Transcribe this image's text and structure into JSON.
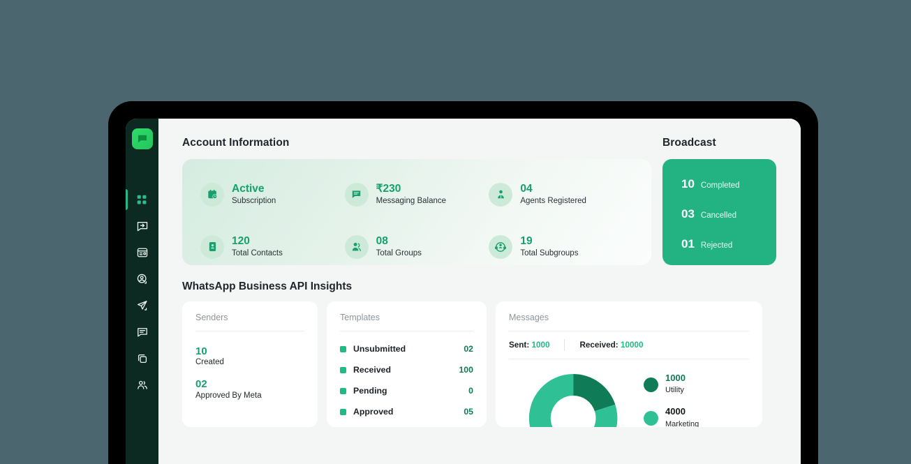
{
  "theme": {
    "page_background": "#4c6670",
    "frame": "#000000",
    "screen": "#f4f6f5",
    "sidebar": "#0c2a22",
    "accent_green": "#16a06e",
    "broadcast_card": "#23b383",
    "legend_dark_green": "#0f7c57",
    "legend_light_green": "#2fc195"
  },
  "sidebar": {
    "logo_icon": "chat-bubble-logo-icon",
    "items": [
      {
        "name": "dashboard",
        "icon": "grid-dashboard-icon",
        "active": true
      },
      {
        "name": "chats",
        "icon": "chat-forward-icon",
        "active": false
      },
      {
        "name": "templates",
        "icon": "window-list-icon",
        "active": false
      },
      {
        "name": "contacts",
        "icon": "user-circle-icon",
        "active": false
      },
      {
        "name": "broadcast",
        "icon": "paper-plane-icon",
        "active": false
      },
      {
        "name": "messages",
        "icon": "chat-lines-icon",
        "active": false
      },
      {
        "name": "copy",
        "icon": "copy-layers-icon",
        "active": false
      },
      {
        "name": "agents",
        "icon": "users-group-icon",
        "active": false
      }
    ]
  },
  "account_information": {
    "title": "Account Information",
    "stats": [
      {
        "icon": "calendar-clock-icon",
        "value": "Active",
        "label": "Subscription"
      },
      {
        "icon": "chat-balance-icon",
        "value": "₹230",
        "label": "Messaging Balance"
      },
      {
        "icon": "agent-badge-icon",
        "value": "04",
        "label": "Agents Registered"
      },
      {
        "icon": "contact-card-icon",
        "value": "120",
        "label": "Total Contacts"
      },
      {
        "icon": "user-group-icon",
        "value": "08",
        "label": "Total Groups"
      },
      {
        "icon": "subgroup-network-icon",
        "value": "19",
        "label": "Total Subgroups"
      }
    ]
  },
  "broadcast": {
    "title": "Broadcast",
    "rows": [
      {
        "count": "10",
        "label": "Completed"
      },
      {
        "count": "03",
        "label": "Cancelled"
      },
      {
        "count": "01",
        "label": "Rejected"
      }
    ]
  },
  "insights": {
    "title": "WhatsApp Business API Insights",
    "senders": {
      "heading": "Senders",
      "items": [
        {
          "value": "10",
          "label": "Created"
        },
        {
          "value": "02",
          "label": "Approved By Meta"
        }
      ]
    },
    "templates": {
      "heading": "Templates",
      "rows": [
        {
          "label": "Unsubmitted",
          "count": "02"
        },
        {
          "label": "Received",
          "count": "100"
        },
        {
          "label": "Pending",
          "count": "0"
        },
        {
          "label": "Approved",
          "count": "05"
        }
      ]
    },
    "messages": {
      "heading": "Messages",
      "sent_label": "Sent:",
      "sent_value": "1000",
      "received_label": "Received:",
      "received_value": "10000"
    }
  },
  "chart_data": {
    "type": "pie",
    "title": "Messages",
    "legend_position": "right",
    "categories": [
      "Utility",
      "Marketing"
    ],
    "values": [
      1000,
      4000
    ],
    "colors": [
      "#0f7c57",
      "#2fc195"
    ],
    "labels": [
      {
        "value": "1000",
        "name": "Utility"
      },
      {
        "value": "4000",
        "name": "Marketing"
      }
    ]
  }
}
